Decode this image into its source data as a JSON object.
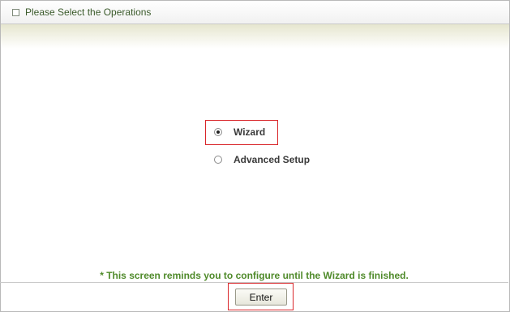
{
  "header": {
    "title": "Please Select the Operations"
  },
  "options": [
    {
      "label": "Wizard",
      "checked": true,
      "highlighted": true
    },
    {
      "label": "Advanced Setup",
      "checked": false,
      "highlighted": false
    }
  ],
  "note": "* This screen reminds you to configure until the Wizard is finished.",
  "enter_button": {
    "label": "Enter",
    "highlighted": true
  },
  "colors": {
    "title_text": "#3a5a2a",
    "note_text": "#4f8a2a",
    "highlight_border": "#d9262a",
    "band_gradient_top": "#e6e6cf"
  }
}
